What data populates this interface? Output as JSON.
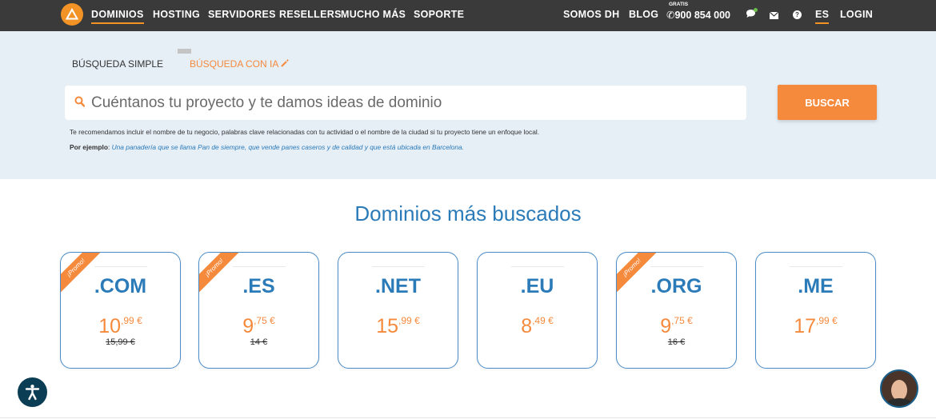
{
  "nav": {
    "left": [
      "DOMINIOS",
      "HOSTING",
      "SERVIDORES",
      "RESELLERS",
      "MUCHO MÁS",
      "SOPORTE"
    ],
    "somos": "SOMOS DH",
    "blog": "BLOG",
    "gratis": "GRATIS",
    "phone": "900 854 000",
    "lang": "ES",
    "login": "LOGIN"
  },
  "search": {
    "tab_simple": "BÚSQUEDA SIMPLE",
    "tab_ia": "BÚSQUEDA CON IA",
    "placeholder": "Cuéntanos tu proyecto y te damos ideas de dominio",
    "button": "BUSCAR",
    "hint": "Te recomendamos incluir el nombre de tu negocio, palabras clave relacionadas con tu actividad o el nombre de la ciudad si tu proyecto tiene un enfoque local.",
    "example_label": "Por ejemplo",
    "example_text": "Una panadería que se llama Pan de siempre, que vende panes caseros y de calidad y que está ubicada en Barcelona."
  },
  "domains": {
    "title": "Dominios más buscados",
    "promo_label": "¡Promo!",
    "cards": [
      {
        "tld": ".COM",
        "price_int": "10",
        "price_dec": ",99 €",
        "old": "15,99 €",
        "promo": true
      },
      {
        "tld": ".ES",
        "price_int": "9",
        "price_dec": ",75 €",
        "old": "14 €",
        "promo": true
      },
      {
        "tld": ".NET",
        "price_int": "15",
        "price_dec": ",99 €",
        "old": "",
        "promo": false
      },
      {
        "tld": ".EU",
        "price_int": "8",
        "price_dec": ",49 €",
        "old": "",
        "promo": false
      },
      {
        "tld": ".ORG",
        "price_int": "9",
        "price_dec": ",75 €",
        "old": "16 €",
        "promo": true
      },
      {
        "tld": ".ME",
        "price_int": "17",
        "price_dec": ",99 €",
        "old": "",
        "promo": false
      }
    ]
  },
  "colors": {
    "accent": "#f58a3c",
    "primary": "#2b7bb9",
    "topbar": "#3a3a3a",
    "search_bg": "#e6eef6"
  }
}
